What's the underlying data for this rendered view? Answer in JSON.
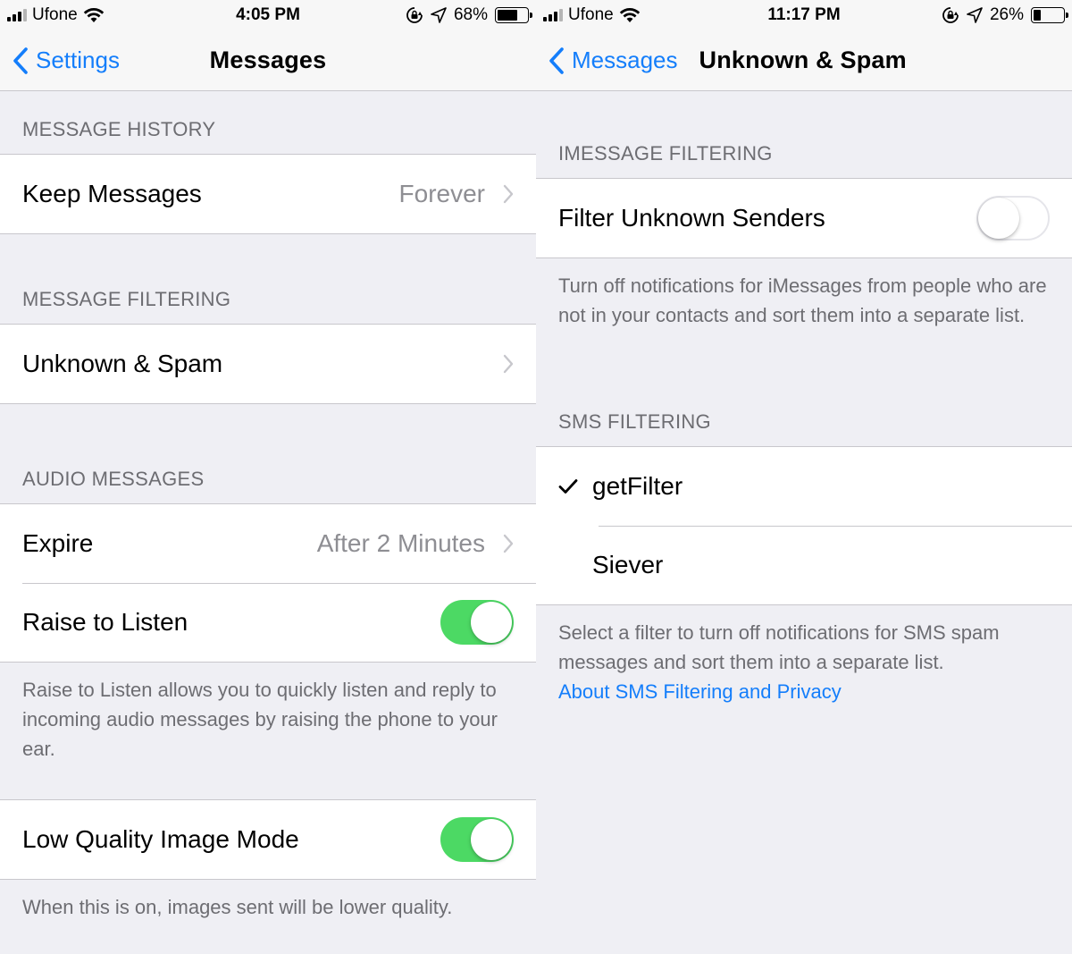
{
  "left": {
    "status": {
      "carrier": "Ufone",
      "time": "4:05 PM",
      "battery_percent": "68%",
      "battery_level": 0.68
    },
    "nav": {
      "back_label": "Settings",
      "title": "Messages"
    },
    "sections": {
      "history_header": "MESSAGE HISTORY",
      "keep_messages_label": "Keep Messages",
      "keep_messages_value": "Forever",
      "filtering_header": "MESSAGE FILTERING",
      "unknown_spam_label": "Unknown & Spam",
      "audio_header": "AUDIO MESSAGES",
      "expire_label": "Expire",
      "expire_value": "After 2 Minutes",
      "raise_label": "Raise to Listen",
      "raise_on": true,
      "raise_footer": "Raise to Listen allows you to quickly listen and reply to incoming audio messages by raising the phone to your ear.",
      "low_quality_label": "Low Quality Image Mode",
      "low_quality_on": true,
      "low_quality_footer": "When this is on, images sent will be lower quality."
    }
  },
  "right": {
    "status": {
      "carrier": "Ufone",
      "time": "11:17 PM",
      "battery_percent": "26%",
      "battery_level": 0.26
    },
    "nav": {
      "back_label": "Messages",
      "title": "Unknown & Spam"
    },
    "sections": {
      "imessage_header": "IMESSAGE FILTERING",
      "filter_unknown_label": "Filter Unknown Senders",
      "filter_unknown_on": false,
      "imessage_footer": "Turn off notifications for iMessages from people who are not in your contacts and sort them into a separate list.",
      "sms_header": "SMS FILTERING",
      "sms_options": [
        "getFilter",
        "Siever"
      ],
      "sms_selected": "getFilter",
      "sms_footer": "Select a filter to turn off notifications for SMS spam messages and sort them into a separate list.",
      "sms_link": "About SMS Filtering and Privacy"
    }
  },
  "colors": {
    "accent": "#147efb",
    "toggle_on": "#4cd964",
    "background": "#efeff4",
    "secondary_text": "#8e8e93"
  },
  "icons": {
    "signal": "cellular-signal-icon",
    "wifi": "wifi-icon",
    "orientation_lock": "orientation-lock-icon",
    "location": "location-arrow-icon",
    "battery": "battery-icon",
    "back": "chevron-left-icon",
    "disclosure": "chevron-right-icon",
    "checkmark": "checkmark-icon"
  }
}
